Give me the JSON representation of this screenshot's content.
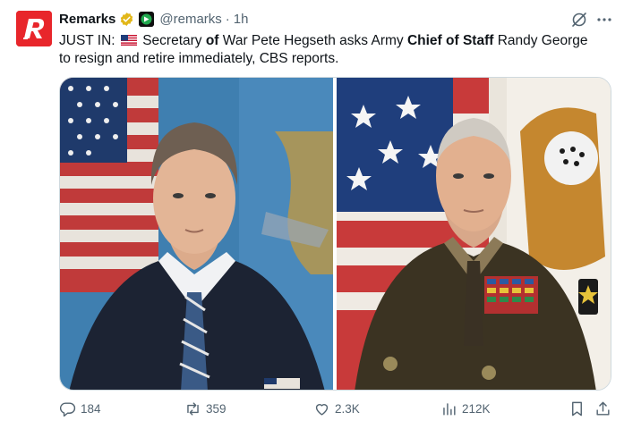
{
  "author": {
    "name": "Remarks",
    "handle": "@remarks",
    "separator": "·",
    "time": "1h"
  },
  "tweet": {
    "part1": "JUST IN: ",
    "part2": " Secretary ",
    "part3": "of",
    "part4": " War Pete Hegseth asks Army ",
    "part5": "Chief of Staff",
    "part6": " Randy George to resign and retire immediately, CBS reports."
  },
  "stats": {
    "replies": "184",
    "reposts": "359",
    "likes": "2.3K",
    "views": "212K"
  },
  "colors": {
    "brand": "#e8262b",
    "verified_gold": "#e2b719",
    "muted": "#536471"
  },
  "icons": [
    "grok-icon",
    "more-icon",
    "reply-icon",
    "repost-icon",
    "like-icon",
    "views-icon",
    "bookmark-icon",
    "share-icon"
  ]
}
